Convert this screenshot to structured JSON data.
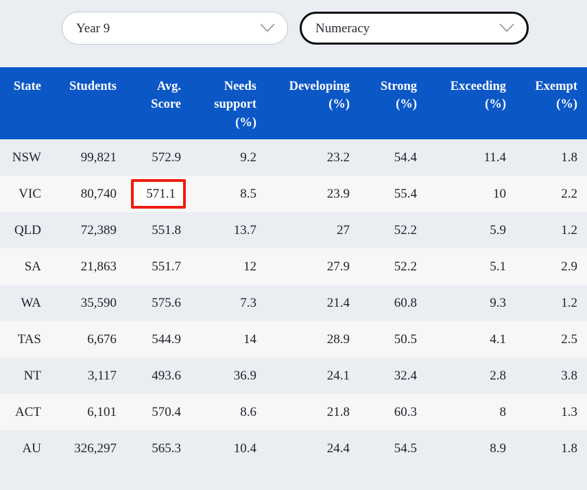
{
  "filters": {
    "year": {
      "label": "Year 9",
      "icon": "chevron-down-icon",
      "focused": false
    },
    "domain": {
      "label": "Numeracy",
      "icon": "chevron-down-icon",
      "focused": true
    }
  },
  "table": {
    "header_bg": "#0b57c6",
    "header_text_color": "#ffffff",
    "row_odd_bg": "#eaeef2",
    "row_even_bg": "#f7f7f7",
    "highlight_color": "#f01c0e",
    "columns": [
      "State",
      "Students",
      "Avg. Score",
      "Needs support (%)",
      "Developing (%)",
      "Strong (%)",
      "Exceeding (%)",
      "Exempt (%)"
    ],
    "columns_lines": [
      [
        "State"
      ],
      [
        "Students"
      ],
      [
        "Avg.",
        "Score"
      ],
      [
        "Needs",
        "support",
        "(%)"
      ],
      [
        "Developing",
        "(%)"
      ],
      [
        "Strong",
        "(%)"
      ],
      [
        "Exceeding",
        "(%)"
      ],
      [
        "Exempt",
        "(%)"
      ]
    ],
    "highlighted": {
      "row": 1,
      "column": 2,
      "value": "571.1"
    },
    "rows": [
      {
        "state": "NSW",
        "students": "99,821",
        "avg_score": "572.9",
        "needs_support": "9.2",
        "developing": "23.2",
        "strong": "54.4",
        "exceeding": "11.4",
        "exempt": "1.8"
      },
      {
        "state": "VIC",
        "students": "80,740",
        "avg_score": "571.1",
        "needs_support": "8.5",
        "developing": "23.9",
        "strong": "55.4",
        "exceeding": "10",
        "exempt": "2.2"
      },
      {
        "state": "QLD",
        "students": "72,389",
        "avg_score": "551.8",
        "needs_support": "13.7",
        "developing": "27",
        "strong": "52.2",
        "exceeding": "5.9",
        "exempt": "1.2"
      },
      {
        "state": "SA",
        "students": "21,863",
        "avg_score": "551.7",
        "needs_support": "12",
        "developing": "27.9",
        "strong": "52.2",
        "exceeding": "5.1",
        "exempt": "2.9"
      },
      {
        "state": "WA",
        "students": "35,590",
        "avg_score": "575.6",
        "needs_support": "7.3",
        "developing": "21.4",
        "strong": "60.8",
        "exceeding": "9.3",
        "exempt": "1.2"
      },
      {
        "state": "TAS",
        "students": "6,676",
        "avg_score": "544.9",
        "needs_support": "14",
        "developing": "28.9",
        "strong": "50.5",
        "exceeding": "4.1",
        "exempt": "2.5"
      },
      {
        "state": "NT",
        "students": "3,117",
        "avg_score": "493.6",
        "needs_support": "36.9",
        "developing": "24.1",
        "strong": "32.4",
        "exceeding": "2.8",
        "exempt": "3.8"
      },
      {
        "state": "ACT",
        "students": "6,101",
        "avg_score": "570.4",
        "needs_support": "8.6",
        "developing": "21.8",
        "strong": "60.3",
        "exceeding": "8",
        "exempt": "1.3"
      },
      {
        "state": "AU",
        "students": "326,297",
        "avg_score": "565.3",
        "needs_support": "10.4",
        "developing": "24.4",
        "strong": "54.5",
        "exceeding": "8.9",
        "exempt": "1.8"
      }
    ]
  }
}
